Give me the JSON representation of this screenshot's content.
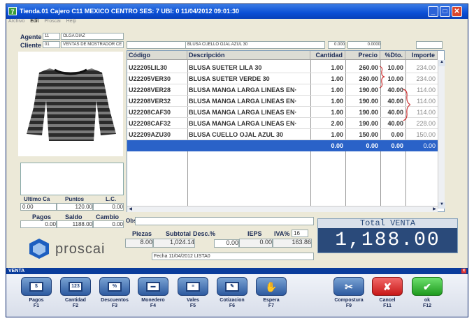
{
  "window": {
    "icon": "7",
    "title": "Tienda.01  Cajero C11  MEXICO CENTRO   SES: 7  UBI: 0   11/04/2012 09:01:30"
  },
  "menu": [
    "Archivo",
    "Edit",
    "Proscai",
    "Help"
  ],
  "agente": {
    "label": "Agente",
    "code": "11",
    "name": "OLGA DIAZ"
  },
  "cliente": {
    "label": "Cliente",
    "code": "01",
    "name": "VENTAS DE MOSTRADOR CE"
  },
  "top_fields": {
    "desc": "BLUSA CUELLO OJAL AZUL 30",
    "v1": "0.000",
    "v2": "0.0000"
  },
  "grid": {
    "headers": [
      "Código",
      "Descripción",
      "Cantidad",
      "Precio",
      "%Dto.",
      "Importe"
    ],
    "rows": [
      [
        "U22205LIL30",
        "BLUSA SUETER LILA 30",
        "1.00",
        "260.00",
        "10.00",
        "234.00"
      ],
      [
        "U22205VER30",
        "BLUSA SUETER VERDE 30",
        "1.00",
        "260.00",
        "10.00",
        "234.00"
      ],
      [
        "U22208VER28",
        "BLUSA MANGA LARGA LINEAS EN·",
        "1.00",
        "190.00",
        "40.00",
        "114.00"
      ],
      [
        "U22208VER32",
        "BLUSA MANGA LARGA LINEAS EN·",
        "1.00",
        "190.00",
        "40.00",
        "114.00"
      ],
      [
        "U22208CAF30",
        "BLUSA MANGA LARGA LINEAS EN·",
        "1.00",
        "190.00",
        "40.00",
        "114.00"
      ],
      [
        "U22208CAF32",
        "BLUSA MANGA LARGA LINEAS EN·",
        "2.00",
        "190.00",
        "40.00",
        "228.00"
      ],
      [
        "U22209AZU30",
        "BLUSA CUELLO OJAL AZUL 30",
        "1.00",
        "150.00",
        "0.00",
        "150.00"
      ]
    ],
    "totals": [
      "0.00",
      "0.00",
      "0.00",
      "0.00"
    ]
  },
  "stats": {
    "ultimo_ca_label": "Ultimo Ca",
    "puntos_label": "Puntos",
    "lc_label": "L.C.",
    "ultimo_ca": "0.00",
    "puntos": "120.00",
    "lc": "0.00",
    "pagos_label": "Pagos",
    "saldo_label": "Saldo",
    "cambio_label": "Cambio",
    "pagos": "0.00",
    "saldo": "1188.00",
    "cambio": "0.00"
  },
  "obs": {
    "label": "Obs"
  },
  "summary": {
    "piezas_label": "Piezas",
    "subtotal_label": "Subtotal",
    "desc_label": "Desc.%",
    "ieps_label": "IEPS",
    "iva_label": "IVA%",
    "iva_rate": "16",
    "piezas": "8.00",
    "subtotal": "1,024.14",
    "desc": "0.00",
    "ieps": "0.00",
    "iva": "163.86"
  },
  "fecha": "Fecha 11/04/2012 LISTA0",
  "logo": "proscai",
  "total": {
    "label": "Total VENTA",
    "value": "1,188.00"
  },
  "venta": {
    "title": "VENTA",
    "buttons": [
      {
        "label": "Pagos",
        "key": "F1",
        "icon": "dollar-icon",
        "glyph": "$"
      },
      {
        "label": "Cantidad",
        "key": "F2",
        "icon": "quantity-icon",
        "glyph": "123"
      },
      {
        "label": "Descuentos",
        "key": "F3",
        "icon": "percent-icon",
        "glyph": "%"
      },
      {
        "label": "Monedero",
        "key": "F4",
        "icon": "card-icon",
        "glyph": "▬"
      },
      {
        "label": "Vales",
        "key": "F5",
        "icon": "voucher-icon",
        "glyph": "≡"
      },
      {
        "label": "Cotizacion",
        "key": "F6",
        "icon": "edit-icon",
        "glyph": "✎"
      },
      {
        "label": "Espera",
        "key": "F7",
        "icon": "hand-icon",
        "glyph": "✋"
      },
      {
        "label": "Compostura",
        "key": "F9",
        "icon": "scissors-icon",
        "glyph": "✂"
      },
      {
        "label": "Cancel",
        "key": "F11",
        "icon": "cancel-icon",
        "glyph": "✘"
      },
      {
        "label": "ok",
        "key": "F12",
        "icon": "check-icon",
        "glyph": "✔"
      }
    ]
  },
  "colors": {
    "title_blue": "#0a4fd6",
    "total_bg": "#2a4a7a",
    "selected_row": "#2a62c8",
    "cancel_red": "#d22",
    "ok_green": "#2a2"
  }
}
